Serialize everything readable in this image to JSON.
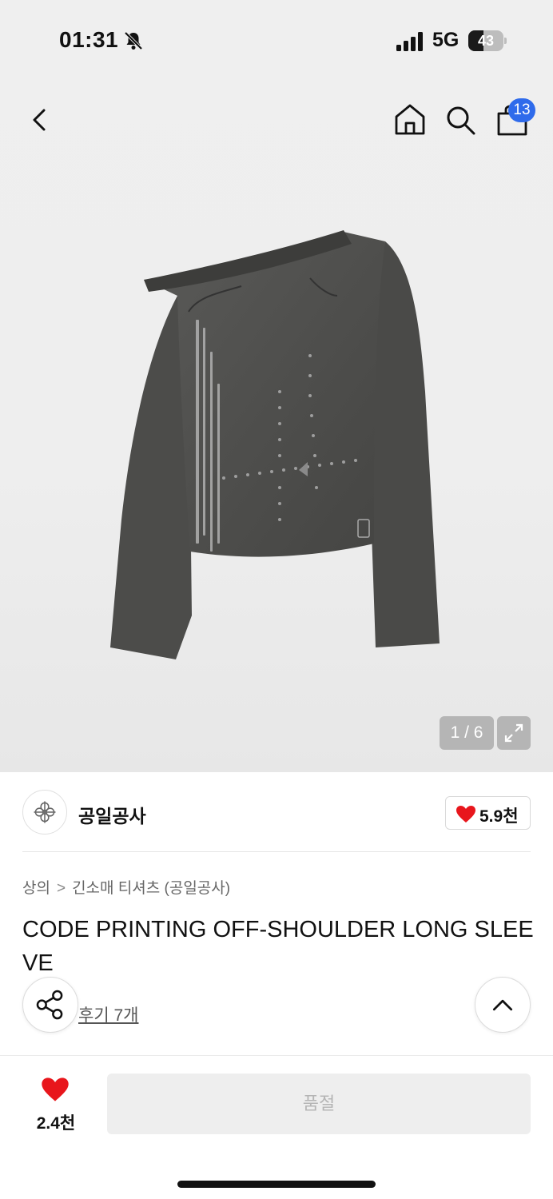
{
  "status_bar": {
    "time": "01:31",
    "network": "5G",
    "battery_level": "43",
    "battery_fraction": 0.43,
    "icons": [
      "bell-slash-icon",
      "signal-icon",
      "battery-icon"
    ]
  },
  "nav": {
    "cart_badge": "13",
    "icons": [
      "back-chevron-icon",
      "home-icon",
      "search-icon",
      "shopping-bag-icon"
    ]
  },
  "gallery": {
    "counter": "1 / 6",
    "current": 1,
    "total": 6,
    "expand_icon": "expand-icon"
  },
  "brand": {
    "name": "공일공사",
    "like_count": "5.9천",
    "like_color": "#E8161C"
  },
  "breadcrumb": {
    "category": "상의",
    "separator": ">",
    "subcategory": "긴소매 티셔츠 (공일공사)"
  },
  "product": {
    "title": "CODE PRINTING OFF-SHOULDER LONG SLEEVE",
    "review_link": "후기 7개"
  },
  "bottom_bar": {
    "wish_count": "2.4천",
    "soldout_label": "품절",
    "accent": "#E8161C"
  },
  "colors": {
    "badge": "#2F6BEB",
    "heart": "#E8161C"
  }
}
